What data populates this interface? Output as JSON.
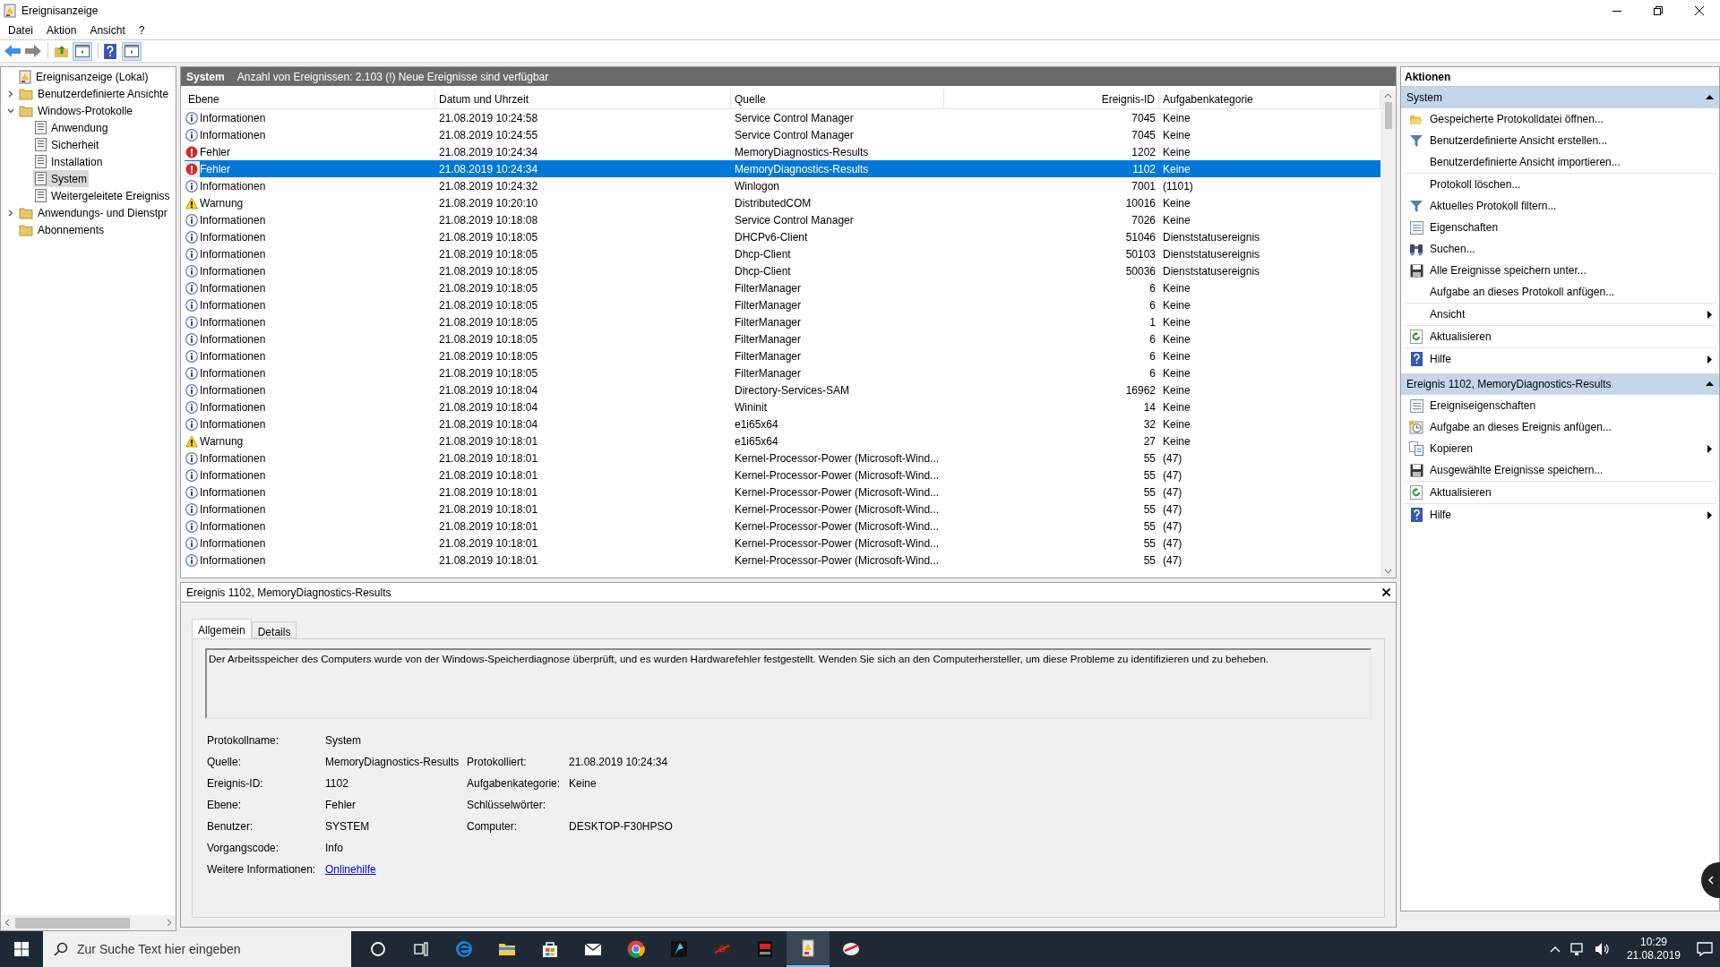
{
  "window": {
    "title": "Ereignisanzeige"
  },
  "menu": [
    "Datei",
    "Aktion",
    "Ansicht",
    "?"
  ],
  "tree": [
    {
      "label": "Ereignisanzeige (Lokal)",
      "selected": false,
      "children": [
        {
          "label": "Benutzerdefinierte Ansichte",
          "selected": false,
          "expanded": false
        },
        {
          "label": "Windows-Protokolle",
          "selected": false,
          "expanded": true,
          "children": [
            {
              "label": "Anwendung",
              "selected": false
            },
            {
              "label": "Sicherheit",
              "selected": false
            },
            {
              "label": "Installation",
              "selected": false
            },
            {
              "label": "System",
              "selected": true
            },
            {
              "label": "Weitergeleitete Ereigniss",
              "selected": false
            }
          ]
        },
        {
          "label": "Anwendungs- und Dienstpr",
          "selected": false,
          "expanded": false
        },
        {
          "label": "Abonnements",
          "selected": false
        }
      ]
    }
  ],
  "log_header": {
    "name": "System",
    "info": "Anzahl von Ereignissen: 2.103 (!) Neue Ereignisse sind verfügbar"
  },
  "table": {
    "columns": [
      "Ebene",
      "Datum und Uhrzeit",
      "Quelle",
      "Ereignis-ID",
      "Aufgabenkategorie"
    ],
    "rows": [
      {
        "kind": "info",
        "level": "Informationen",
        "date": "21.08.2019 10:24:58",
        "source": "Service Control Manager",
        "id": "7045",
        "category": "Keine",
        "selected": false
      },
      {
        "kind": "info",
        "level": "Informationen",
        "date": "21.08.2019 10:24:55",
        "source": "Service Control Manager",
        "id": "7045",
        "category": "Keine",
        "selected": false
      },
      {
        "kind": "error",
        "level": "Fehler",
        "date": "21.08.2019 10:24:34",
        "source": "MemoryDiagnostics-Results",
        "id": "1202",
        "category": "Keine",
        "selected": false
      },
      {
        "kind": "error",
        "level": "Fehler",
        "date": "21.08.2019 10:24:34",
        "source": "MemoryDiagnostics-Results",
        "id": "1102",
        "category": "Keine",
        "selected": true
      },
      {
        "kind": "info",
        "level": "Informationen",
        "date": "21.08.2019 10:24:32",
        "source": "Winlogon",
        "id": "7001",
        "category": "(1101)",
        "selected": false
      },
      {
        "kind": "warning",
        "level": "Warnung",
        "date": "21.08.2019 10:20:10",
        "source": "DistributedCOM",
        "id": "10016",
        "category": "Keine",
        "selected": false
      },
      {
        "kind": "info",
        "level": "Informationen",
        "date": "21.08.2019 10:18:08",
        "source": "Service Control Manager",
        "id": "7026",
        "category": "Keine",
        "selected": false
      },
      {
        "kind": "info",
        "level": "Informationen",
        "date": "21.08.2019 10:18:05",
        "source": "DHCPv6-Client",
        "id": "51046",
        "category": "Dienststatusereignis",
        "selected": false
      },
      {
        "kind": "info",
        "level": "Informationen",
        "date": "21.08.2019 10:18:05",
        "source": "Dhcp-Client",
        "id": "50103",
        "category": "Dienststatusereignis",
        "selected": false
      },
      {
        "kind": "info",
        "level": "Informationen",
        "date": "21.08.2019 10:18:05",
        "source": "Dhcp-Client",
        "id": "50036",
        "category": "Dienststatusereignis",
        "selected": false
      },
      {
        "kind": "info",
        "level": "Informationen",
        "date": "21.08.2019 10:18:05",
        "source": "FilterManager",
        "id": "6",
        "category": "Keine",
        "selected": false
      },
      {
        "kind": "info",
        "level": "Informationen",
        "date": "21.08.2019 10:18:05",
        "source": "FilterManager",
        "id": "6",
        "category": "Keine",
        "selected": false
      },
      {
        "kind": "info",
        "level": "Informationen",
        "date": "21.08.2019 10:18:05",
        "source": "FilterManager",
        "id": "1",
        "category": "Keine",
        "selected": false
      },
      {
        "kind": "info",
        "level": "Informationen",
        "date": "21.08.2019 10:18:05",
        "source": "FilterManager",
        "id": "6",
        "category": "Keine",
        "selected": false
      },
      {
        "kind": "info",
        "level": "Informationen",
        "date": "21.08.2019 10:18:05",
        "source": "FilterManager",
        "id": "6",
        "category": "Keine",
        "selected": false
      },
      {
        "kind": "info",
        "level": "Informationen",
        "date": "21.08.2019 10:18:05",
        "source": "FilterManager",
        "id": "6",
        "category": "Keine",
        "selected": false
      },
      {
        "kind": "info",
        "level": "Informationen",
        "date": "21.08.2019 10:18:04",
        "source": "Directory-Services-SAM",
        "id": "16962",
        "category": "Keine",
        "selected": false
      },
      {
        "kind": "info",
        "level": "Informationen",
        "date": "21.08.2019 10:18:04",
        "source": "Wininit",
        "id": "14",
        "category": "Keine",
        "selected": false
      },
      {
        "kind": "info",
        "level": "Informationen",
        "date": "21.08.2019 10:18:04",
        "source": "e1i65x64",
        "id": "32",
        "category": "Keine",
        "selected": false
      },
      {
        "kind": "warning",
        "level": "Warnung",
        "date": "21.08.2019 10:18:01",
        "source": "e1i65x64",
        "id": "27",
        "category": "Keine",
        "selected": false
      },
      {
        "kind": "info",
        "level": "Informationen",
        "date": "21.08.2019 10:18:01",
        "source": "Kernel-Processor-Power (Microsoft-Wind...",
        "id": "55",
        "category": "(47)",
        "selected": false
      },
      {
        "kind": "info",
        "level": "Informationen",
        "date": "21.08.2019 10:18:01",
        "source": "Kernel-Processor-Power (Microsoft-Wind...",
        "id": "55",
        "category": "(47)",
        "selected": false
      },
      {
        "kind": "info",
        "level": "Informationen",
        "date": "21.08.2019 10:18:01",
        "source": "Kernel-Processor-Power (Microsoft-Wind...",
        "id": "55",
        "category": "(47)",
        "selected": false
      },
      {
        "kind": "info",
        "level": "Informationen",
        "date": "21.08.2019 10:18:01",
        "source": "Kernel-Processor-Power (Microsoft-Wind...",
        "id": "55",
        "category": "(47)",
        "selected": false
      },
      {
        "kind": "info",
        "level": "Informationen",
        "date": "21.08.2019 10:18:01",
        "source": "Kernel-Processor-Power (Microsoft-Wind...",
        "id": "55",
        "category": "(47)",
        "selected": false
      },
      {
        "kind": "info",
        "level": "Informationen",
        "date": "21.08.2019 10:18:01",
        "source": "Kernel-Processor-Power (Microsoft-Wind...",
        "id": "55",
        "category": "(47)",
        "selected": false
      },
      {
        "kind": "info",
        "level": "Informationen",
        "date": "21.08.2019 10:18:01",
        "source": "Kernel-Processor-Power (Microsoft-Wind...",
        "id": "55",
        "category": "(47)",
        "selected": false
      }
    ]
  },
  "detail": {
    "title": "Ereignis 1102, MemoryDiagnostics-Results",
    "tabs": [
      {
        "label": "Allgemein",
        "selected": true
      },
      {
        "label": "Details",
        "selected": false
      }
    ],
    "description": "Der Arbeitsspeicher des Computers wurde von der Windows-Speicherdiagnose überprüft, und es wurden Hardwarefehler festgestellt. Wenden Sie sich an den Computerhersteller, um diese Probleme zu identifizieren und zu beheben.",
    "fields": [
      {
        "label": "Protokollname:",
        "value": "System"
      },
      {
        "label": "Quelle:",
        "value": "MemoryDiagnostics-Results",
        "label2": "Protokolliert:",
        "value2": "21.08.2019 10:24:34"
      },
      {
        "label": "Ereignis-ID:",
        "value": "1102",
        "label2": "Aufgabenkategorie:",
        "value2": "Keine"
      },
      {
        "label": "Ebene:",
        "value": "Fehler",
        "label2": "Schlüsselwörter:"
      },
      {
        "label": "Benutzer:",
        "value": "SYSTEM",
        "label2": "Computer:",
        "value2": "DESKTOP-F30HPSO"
      },
      {
        "label": "Vorgangscode:",
        "value": "Info"
      },
      {
        "label": "Weitere Informationen:",
        "link": "Onlinehilfe"
      }
    ]
  },
  "actions": {
    "title": "Aktionen",
    "sections": [
      {
        "title": "System",
        "expanded": true,
        "groups": [
          [
            {
              "kind": "open",
              "label": "Gespeicherte Protokolldatei öffnen..."
            },
            {
              "kind": "filter",
              "label": "Benutzerdefinierte Ansicht erstellen..."
            },
            {
              "kind": "plain",
              "label": "Benutzerdefinierte Ansicht importieren..."
            }
          ],
          [
            {
              "kind": "plain",
              "label": "Protokoll löschen..."
            },
            {
              "kind": "filter",
              "label": "Aktuelles Protokoll filtern..."
            },
            {
              "kind": "properties",
              "label": "Eigenschaften"
            },
            {
              "kind": "find",
              "label": "Suchen..."
            },
            {
              "kind": "save",
              "label": "Alle Ereignisse speichern unter..."
            },
            {
              "kind": "plain",
              "label": "Aufgabe an dieses Protokoll anfügen..."
            }
          ],
          [
            {
              "kind": "plain",
              "label": "Ansicht",
              "submenu": true
            }
          ],
          [
            {
              "kind": "refresh",
              "label": "Aktualisieren"
            }
          ],
          [
            {
              "kind": "help",
              "label": "Hilfe",
              "submenu": true
            }
          ]
        ]
      },
      {
        "title": "Ereignis 1102, MemoryDiagnostics-Results",
        "expanded": true,
        "groups": [
          [
            {
              "kind": "properties",
              "label": "Ereigniseigenschaften"
            },
            {
              "kind": "task",
              "label": "Aufgabe an dieses Ereignis anfügen..."
            },
            {
              "kind": "copy",
              "label": "Kopieren",
              "submenu": true
            },
            {
              "kind": "save",
              "label": "Ausgewählte Ereignisse speichern..."
            }
          ],
          [
            {
              "kind": "refresh",
              "label": "Aktualisieren"
            }
          ],
          [
            {
              "kind": "help",
              "label": "Hilfe",
              "submenu": true
            }
          ]
        ]
      }
    ]
  },
  "taskbar": {
    "search": {
      "placeholder": "Zur Suche Text hier eingeben"
    },
    "time": "10:29",
    "date": "21.08.2019"
  }
}
